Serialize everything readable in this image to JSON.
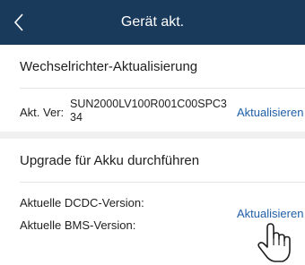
{
  "header": {
    "title": "Gerät akt.",
    "background": "#1a3a5c"
  },
  "inverter_section": {
    "title": "Wechselrichter-Aktualisierung",
    "version_label": "Akt. Ver:",
    "version_value_line1": "SUN2000LV100R001C00SPC3",
    "version_value_line2": "34",
    "update_label": "Aktualisieren"
  },
  "battery_section": {
    "title": "Upgrade für Akku durchführen",
    "dcdc_label": "Aktuelle DCDC-Version:",
    "bms_label": "Aktuelle BMS-Version:",
    "update_label": "Aktualisieren"
  },
  "icons": {
    "back": "chevron-left-icon",
    "pointer": "hand-pointer-icon"
  },
  "colors": {
    "header_bg": "#1a3a5c",
    "link": "#1f5fa8",
    "separator": "#f0f0f0"
  }
}
